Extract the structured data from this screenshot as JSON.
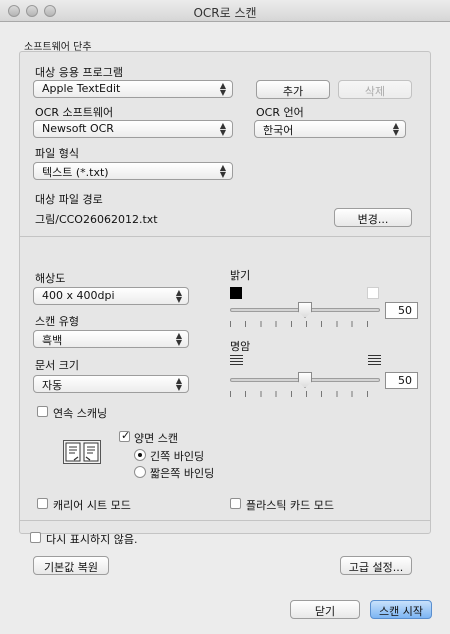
{
  "window": {
    "title": "OCR로 스캔"
  },
  "group_title": "소프트웨어 단추",
  "target_app": {
    "label": "대상 응용 프로그램",
    "value": "Apple TextEdit",
    "add": "추가",
    "delete": "삭제"
  },
  "ocr_software": {
    "label": "OCR 소프트웨어",
    "value": "Newsoft OCR"
  },
  "ocr_language": {
    "label": "OCR 언어",
    "value": "한국어"
  },
  "file_type": {
    "label": "파일 형식",
    "value": "텍스트 (*.txt)"
  },
  "dest_path": {
    "label": "대상 파일 경로",
    "value": "그림/CCO26062012.txt",
    "change": "변경..."
  },
  "resolution": {
    "label": "해상도",
    "value": "400 x 400dpi"
  },
  "scan_type": {
    "label": "스캔 유형",
    "value": "흑백"
  },
  "doc_size": {
    "label": "문서 크기",
    "value": "자동"
  },
  "brightness": {
    "label": "밝기",
    "value": "50"
  },
  "contrast": {
    "label": "명암",
    "value": "50"
  },
  "continuous_scan": {
    "label": "연속 스캐닝",
    "checked": false
  },
  "duplex": {
    "label": "양면 스캔",
    "checked": true,
    "long_edge": "긴쪽 바인딩",
    "short_edge": "짧은쪽 바인딩",
    "selected": "long_edge"
  },
  "carrier_sheet": {
    "label": "캐리어 시트 모드",
    "checked": false
  },
  "plastic_card": {
    "label": "플라스틱 카드 모드",
    "checked": false
  },
  "dont_show": {
    "label": "다시 표시하지 않음.",
    "checked": false
  },
  "buttons": {
    "restore": "기본값 복원",
    "advanced": "고급 설정...",
    "close": "닫기",
    "start": "스캔 시작"
  },
  "colors": {
    "primary_button": "#7db5f3",
    "background": "#ececec"
  }
}
